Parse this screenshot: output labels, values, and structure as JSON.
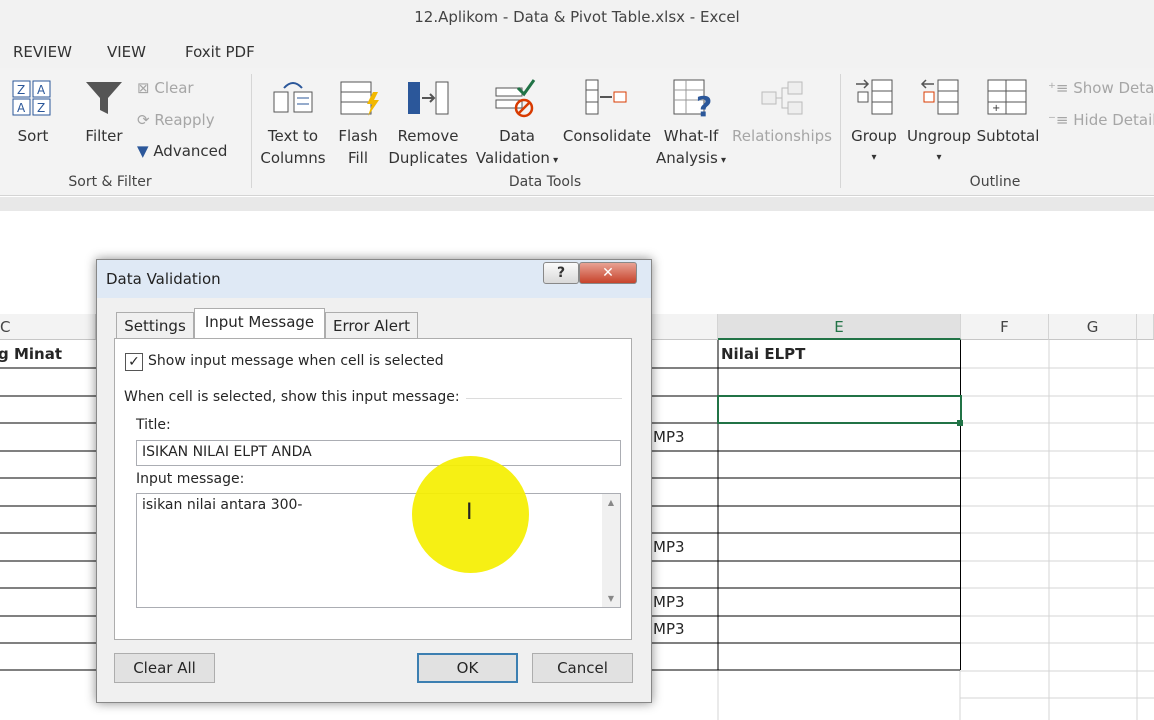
{
  "window": {
    "title": "12.Aplikom - Data & Pivot Table.xlsx - Excel"
  },
  "menu": {
    "tabs": [
      "REVIEW",
      "VIEW",
      "Foxit PDF"
    ]
  },
  "ribbon": {
    "sort_filter": {
      "sort": "Sort",
      "filter": "Filter",
      "clear": "Clear",
      "reapply": "Reapply",
      "advanced": "Advanced",
      "group_label": "Sort & Filter"
    },
    "data_tools": {
      "text_to_columns": [
        "Text to",
        "Columns"
      ],
      "flash_fill": [
        "Flash",
        "Fill"
      ],
      "remove_duplicates": [
        "Remove",
        "Duplicates"
      ],
      "data_validation": [
        "Data",
        "Validation"
      ],
      "consolidate": "Consolidate",
      "what_if": [
        "What-If",
        "Analysis"
      ],
      "relationships": "Relationships",
      "group_label": "Data Tools"
    },
    "outline": {
      "group": "Group",
      "ungroup": "Ungroup",
      "subtotal": "Subtotal",
      "show_detail": "Show Detail",
      "hide_detail": "Hide Detail",
      "group_label": "Outline"
    }
  },
  "sheet": {
    "columns": [
      "C",
      "E",
      "F",
      "G"
    ],
    "header_c": "g Minat",
    "header_e": "Nilai ELPT",
    "partial_cells": [
      "MP3",
      "MP3",
      "MP3",
      "MP3"
    ]
  },
  "dialog": {
    "title": "Data Validation",
    "help": "?",
    "close": "✕",
    "tabs": [
      "Settings",
      "Input Message",
      "Error Alert"
    ],
    "checkbox_label": "Show input message when cell is selected",
    "checkbox_checked": true,
    "section_label": "When cell is selected, show this input message:",
    "title_label": "Title:",
    "title_value": "ISIKAN NILAI ELPT ANDA",
    "message_label": "Input message:",
    "message_value": "isikan nilai antara 300-",
    "buttons": {
      "clear_all": "Clear All",
      "ok": "OK",
      "cancel": "Cancel"
    }
  },
  "colors": {
    "accent": "#217346",
    "highlight": "#f5ef00"
  }
}
